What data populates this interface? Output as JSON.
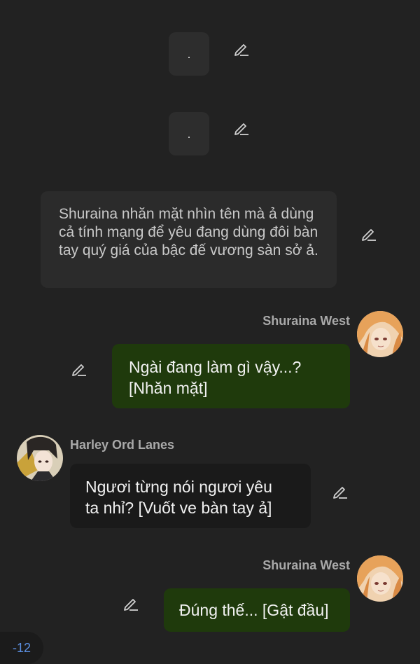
{
  "messages": {
    "dot1": ".",
    "dot2": ".",
    "narration": "Shuraina nhăn mặt nhìn tên mà ả dùng cả tính mạng để yêu đang dùng đôi bàn tay quý giá của bậc đế vương sàn sở ả.",
    "msg1_sender": "Shuraina West",
    "msg1_text_line1": "Ngài đang làm gì vậy...?",
    "msg1_text_line2": "[Nhăn mặt]",
    "msg2_sender": "Harley Ord Lanes",
    "msg2_text_line1": "Ngươi từng nói ngươi yêu",
    "msg2_text_line2": "ta nhỉ? [Vuốt ve bàn tay ả]",
    "msg3_sender": "Shuraina West",
    "msg3_text": "Đúng thế... [Gật đầu]"
  },
  "counter": "-12",
  "icons": {
    "edit": "pencil-edit-icon",
    "avatar_shuraina": "avatar-shuraina-west",
    "avatar_harley": "avatar-harley-ord-lanes"
  },
  "colors": {
    "background": "#222222",
    "green_bubble": "#1f3a0c",
    "dark_bubble": "#1a1a1a",
    "narration_bubble": "#2b2b2b",
    "counter_text": "#5b8fe0"
  }
}
